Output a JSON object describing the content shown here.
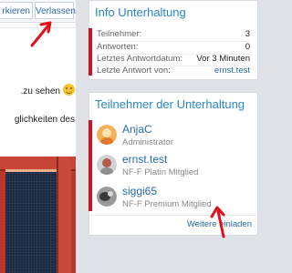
{
  "toolbar": {
    "partial_button_label": "rkieren",
    "leave_button_label": "Verlassen"
  },
  "message": {
    "line1": "zu sehen.",
    "line2": "glichkeiten des"
  },
  "info_panel": {
    "title": "Info Unterhaltung",
    "rows": [
      {
        "label": "Teilnehmer:",
        "value": "3"
      },
      {
        "label": "Antworten:",
        "value": "0"
      },
      {
        "label": "Letztes Antwortdatum:",
        "value": "Vor 3 Minuten"
      },
      {
        "label": "Letzte Antwort von:",
        "value": "ernst.test"
      }
    ]
  },
  "participants_panel": {
    "title": "Teilnehmer der Unterhaltung",
    "members": [
      {
        "name": "AnjaC",
        "role": "Administrator"
      },
      {
        "name": "ernst.test",
        "role": "NF-F Platin Mitglied"
      },
      {
        "name": "siggi65",
        "role": "NF-F Premium Mitglied"
      }
    ],
    "invite_link": "Weitere einladen"
  },
  "colors": {
    "accent_red": "#d3101d",
    "title_blue": "#2a86c8",
    "link_blue": "#2a6aa8",
    "annotation_arrow_red": "#e0121b"
  }
}
